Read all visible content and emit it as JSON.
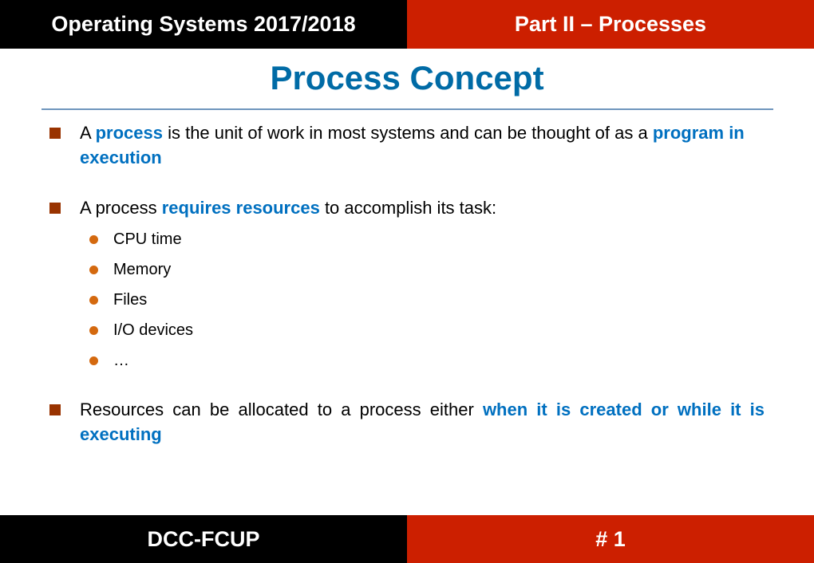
{
  "header": {
    "course": "Operating Systems 2017/2018",
    "part": "Part II – Processes"
  },
  "slide": {
    "title": "Process Concept",
    "bullets": [
      {
        "segments": [
          {
            "text": "A ",
            "highlight": false
          },
          {
            "text": "process",
            "highlight": true
          },
          {
            "text": " is the unit of work in most systems and can be thought of as a ",
            "highlight": false
          },
          {
            "text": "program in execution",
            "highlight": true
          }
        ]
      },
      {
        "segments": [
          {
            "text": "A process ",
            "highlight": false
          },
          {
            "text": "requires resources",
            "highlight": true
          },
          {
            "text": " to accomplish its task:",
            "highlight": false
          }
        ],
        "subitems": [
          "CPU time",
          "Memory",
          "Files",
          "I/O devices",
          "…"
        ]
      },
      {
        "segments": [
          {
            "text": "Resources can be allocated to a process either ",
            "highlight": false
          },
          {
            "text": "when it is created or while it is executing",
            "highlight": true
          }
        ]
      }
    ]
  },
  "footer": {
    "institution": "DCC-FCUP",
    "page": "# 1"
  },
  "colors": {
    "black_bar": "#000000",
    "red_bar": "#cc1f00",
    "title_blue": "#006ba6",
    "highlight_blue": "#0070c0",
    "square_bullet": "#993300",
    "dot_bullet": "#d4690f"
  }
}
